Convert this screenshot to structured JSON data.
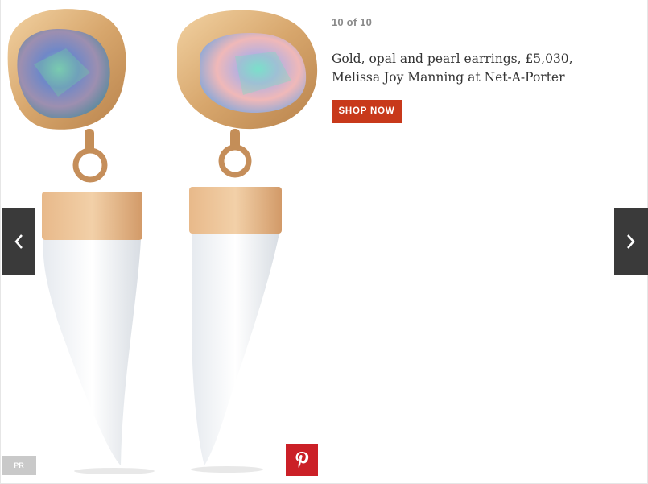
{
  "slideshow": {
    "counter": "10 of 10",
    "caption_line1": "Gold, opal and pearl earrings, £5,030,",
    "caption_line2": "Melissa Joy Manning at Net-A-Porter",
    "shop_label": "SHOP NOW",
    "credit": "PR"
  },
  "icons": {
    "prev": "chevron-left-icon",
    "next": "chevron-right-icon",
    "pin": "pinterest-icon"
  },
  "colors": {
    "shop_button": "#c8391b",
    "nav_arrows": "#3a3a3a",
    "pinterest": "#cb2027",
    "credit_badge": "#c9c9c9"
  }
}
